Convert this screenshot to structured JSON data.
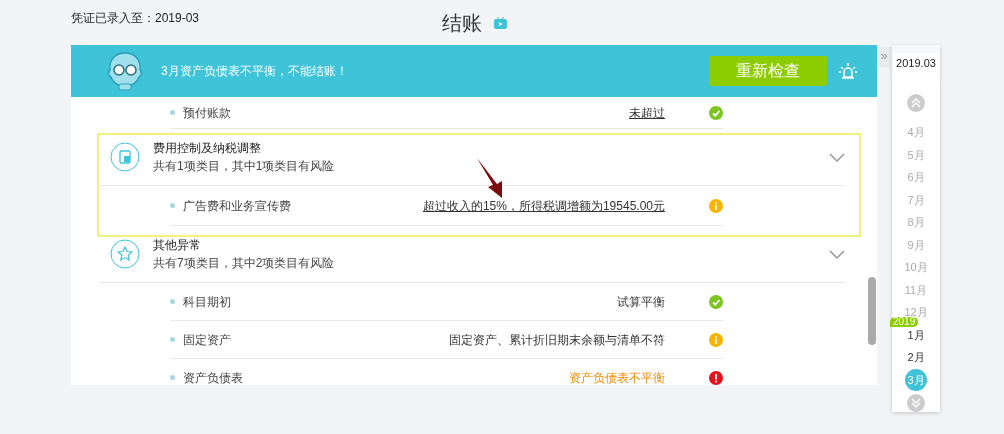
{
  "header": {
    "entered_label": "凭证已录入至：2019-03",
    "title": "结账"
  },
  "alert": {
    "message": "3月资产负债表不平衡，不能结账！",
    "button": "重新检查"
  },
  "rows": [
    {
      "kind": "item",
      "name": "预付账款",
      "result": "未超过",
      "link": true,
      "status_icon": {
        "kind": "ok"
      }
    },
    {
      "kind": "group",
      "title": "费用控制及纳税调整",
      "summary": "共有1项类目，其中1项类目有风险"
    },
    {
      "kind": "item",
      "name": "广告费和业务宣传费",
      "result": "超过收入的15%，所得税调增额为19545.00元",
      "link": true,
      "status_icon": {
        "kind": "warn"
      }
    },
    {
      "kind": "group",
      "title": "其他异常",
      "summary": "共有7项类目，其中2项类目有风险"
    },
    {
      "kind": "item",
      "name": "科目期初",
      "result": "试算平衡",
      "link": false,
      "status_icon": {
        "kind": "ok"
      }
    },
    {
      "kind": "item",
      "name": "固定资产",
      "result": "固定资产、累计折旧期末余额与清单不符",
      "link": false,
      "status_icon": {
        "kind": "warn"
      }
    },
    {
      "kind": "item",
      "name": "资产负债表",
      "result": "资产负债表不平衡",
      "link": false,
      "status_icon": {
        "kind": "error"
      }
    }
  ],
  "collapse_glyph": "»",
  "month_picker": {
    "current": "2019.03",
    "months": [
      {
        "label": "4月",
        "dimmed": true,
        "selected": false
      },
      {
        "label": "5月",
        "dimmed": true,
        "selected": false
      },
      {
        "label": "6月",
        "dimmed": true,
        "selected": false
      },
      {
        "label": "7月",
        "dimmed": true,
        "selected": false
      },
      {
        "label": "8月",
        "dimmed": true,
        "selected": false
      },
      {
        "label": "9月",
        "dimmed": true,
        "selected": false
      },
      {
        "label": "10月",
        "dimmed": true,
        "selected": false
      },
      {
        "label": "11月",
        "dimmed": true,
        "selected": false
      },
      {
        "label": "12月",
        "dimmed": true,
        "selected": false
      },
      {
        "label": "1月",
        "dimmed": false,
        "selected": false,
        "year_tag": "2019"
      },
      {
        "label": "2月",
        "dimmed": false,
        "selected": false
      },
      {
        "label": "3月",
        "dimmed": false,
        "selected": true
      }
    ]
  }
}
